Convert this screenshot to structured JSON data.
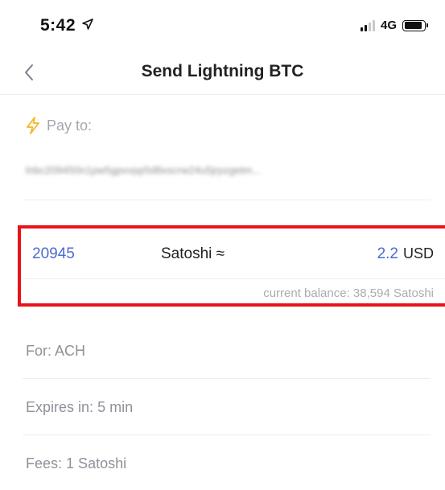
{
  "status_bar": {
    "time": "5:42",
    "network": "4G"
  },
  "nav": {
    "title": "Send Lightning BTC",
    "back_icon": "chevron-left-icon"
  },
  "pay_to": {
    "label": "Pay to:",
    "icon": "lightning-icon",
    "icon_color": "#f5b52a",
    "invoice": "lnbc209450n1pw5gpvvpp5d8xscrw24u5jrpzgetm..."
  },
  "amount": {
    "value": "20945",
    "unit": "Satoshi ≈",
    "usd_value": "2.2",
    "usd_label": "USD",
    "balance": "current balance: 38,594 Satoshi",
    "accent_color": "#4a6bd0",
    "highlight_color": "#e8141b"
  },
  "details": {
    "for_label": "For:",
    "for_value": "ACH",
    "expires_label": "Expires in:",
    "expires_value": "5 min",
    "fees_label": "Fees:",
    "fees_value": "1 Satoshi"
  }
}
